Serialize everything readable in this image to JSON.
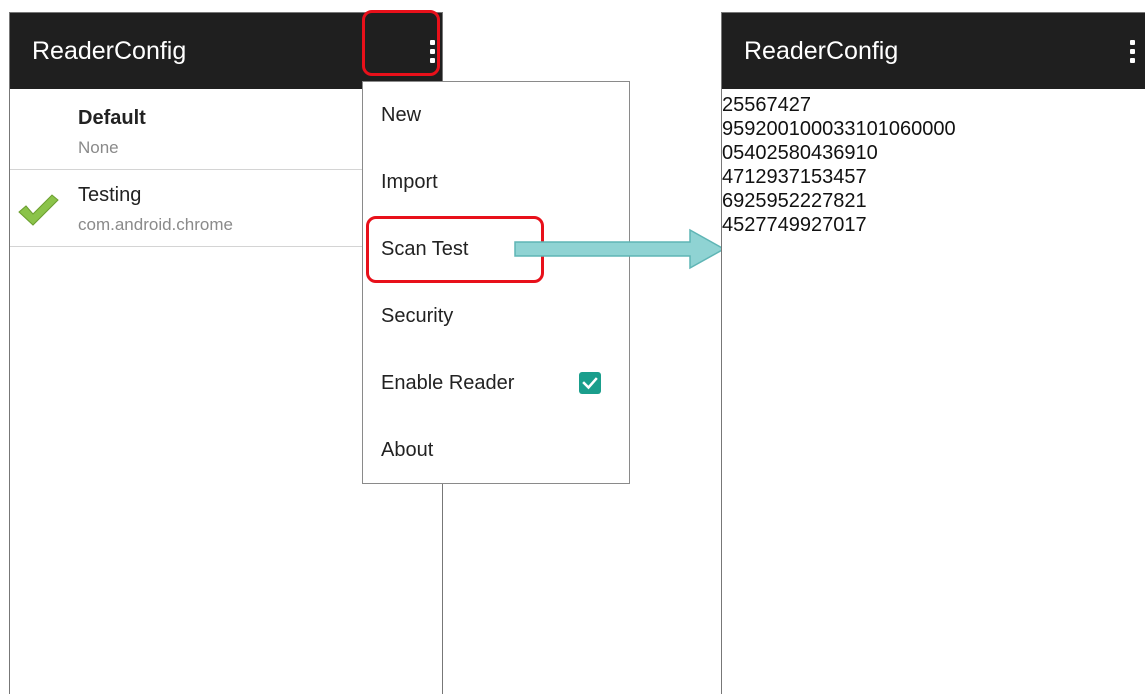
{
  "left_screen": {
    "app_title": "ReaderConfig",
    "overflow_icon": "more-vert-icon",
    "profiles": [
      {
        "name": "Default",
        "subtitle": "None",
        "active": false
      },
      {
        "name": "Testing",
        "subtitle": "com.android.chrome",
        "active": true
      }
    ]
  },
  "overflow_menu": {
    "items": [
      {
        "label": "New"
      },
      {
        "label": "Import"
      },
      {
        "label": "Scan Test"
      },
      {
        "label": "Security"
      },
      {
        "label": "Enable Reader",
        "checked": true
      },
      {
        "label": "About"
      }
    ]
  },
  "right_screen": {
    "app_title": "ReaderConfig",
    "overflow_icon": "more-vert-icon",
    "scan_results": [
      "25567427",
      "959200100033101060000",
      "05402580436910",
      "4712937153457",
      "6925952227821",
      "4527749927017"
    ]
  },
  "colors": {
    "appbar": "#1f1f1f",
    "highlight": "#e8101a",
    "arrow": "#8fd3d3",
    "checkbox": "#1a9e8c",
    "checkmark": "#8bc34a"
  }
}
